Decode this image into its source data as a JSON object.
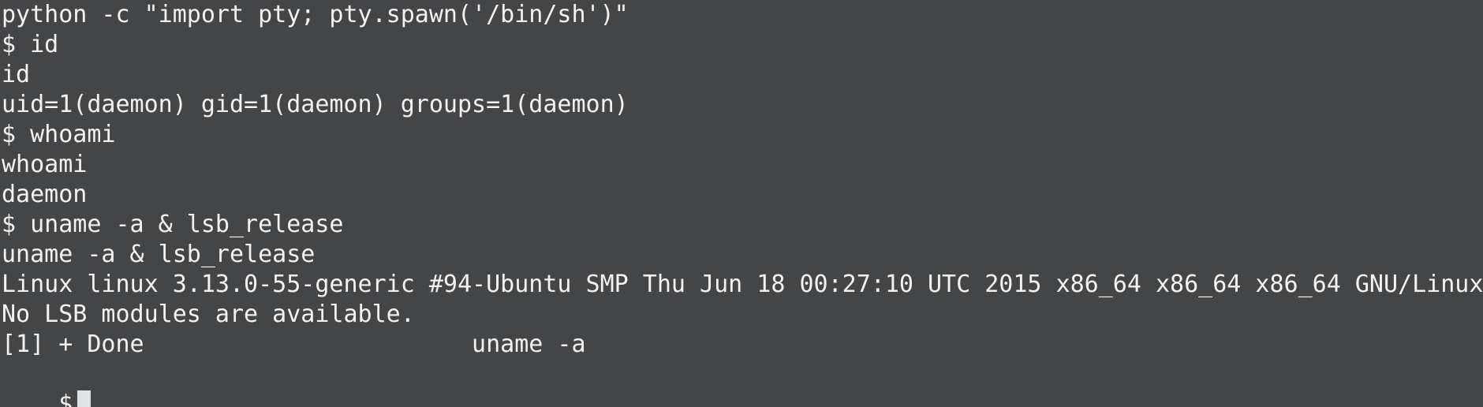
{
  "terminal": {
    "lines": [
      "python -c \"import pty; pty.spawn('/bin/sh')\"",
      "$ id",
      "id",
      "uid=1(daemon) gid=1(daemon) groups=1(daemon)",
      "$ whoami",
      "whoami",
      "daemon",
      "$ uname -a & lsb_release",
      "uname -a & lsb_release",
      "Linux linux 3.13.0-55-generic #94-Ubuntu SMP Thu Jun 18 00:27:10 UTC 2015 x86_64 x86_64 x86_64 GNU/Linux",
      "No LSB modules are available.",
      "[1] + Done                       uname -a"
    ],
    "prompt": "$",
    "colors": {
      "background": "#444547",
      "foreground": "#f2f2f2",
      "cursor": "#dfe3e3"
    }
  }
}
